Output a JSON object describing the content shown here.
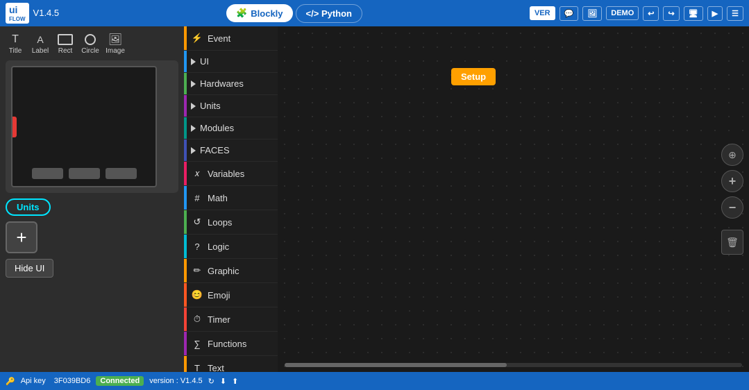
{
  "app": {
    "title": "UI Flow",
    "version": "V1.4.5"
  },
  "topbar": {
    "logo": "UI",
    "logo_sub": "FLOW",
    "version_label": "V1.4.5",
    "tab_blockly": "Blockly",
    "tab_python": "</> Python",
    "btn_ver": "VER",
    "btn_chat": "💬",
    "btn_image": "🖼",
    "btn_demo": "DEMO",
    "btn_undo": "↩",
    "btn_redo": "↪",
    "btn_monitor": "🖥",
    "btn_run": "▶",
    "btn_menu": "☰"
  },
  "left_panel": {
    "tools": [
      {
        "name": "Title",
        "shape": "T"
      },
      {
        "name": "Label",
        "shape": "A"
      },
      {
        "name": "Rect",
        "shape": "▭"
      },
      {
        "name": "Circle",
        "shape": "○"
      },
      {
        "name": "Image",
        "shape": "🖼"
      }
    ],
    "units_badge": "Units",
    "add_button_label": "+",
    "hide_ui_label": "Hide UI"
  },
  "sidebar": {
    "items": [
      {
        "id": "event",
        "label": "Event",
        "color": "#ff9800",
        "has_arrow": false,
        "icon": "⚡"
      },
      {
        "id": "ui",
        "label": "UI",
        "color": "#2196f3",
        "has_arrow": true,
        "icon": ""
      },
      {
        "id": "hardwares",
        "label": "Hardwares",
        "color": "#4caf50",
        "has_arrow": true,
        "icon": ""
      },
      {
        "id": "units",
        "label": "Units",
        "color": "#9c27b0",
        "has_arrow": true,
        "icon": ""
      },
      {
        "id": "modules",
        "label": "Modules",
        "color": "#009688",
        "has_arrow": true,
        "icon": ""
      },
      {
        "id": "faces",
        "label": "FACES",
        "color": "#3f51b5",
        "has_arrow": true,
        "icon": ""
      },
      {
        "id": "variables",
        "label": "Variables",
        "color": "#e91e63",
        "has_arrow": false,
        "icon": "𝑥"
      },
      {
        "id": "math",
        "label": "Math",
        "color": "#2196f3",
        "has_arrow": false,
        "icon": "#"
      },
      {
        "id": "loops",
        "label": "Loops",
        "color": "#4caf50",
        "has_arrow": false,
        "icon": "↺"
      },
      {
        "id": "logic",
        "label": "Logic",
        "color": "#00bcd4",
        "has_arrow": false,
        "icon": "?"
      },
      {
        "id": "graphic",
        "label": "Graphic",
        "color": "#ff9800",
        "has_arrow": false,
        "icon": "✏"
      },
      {
        "id": "emoji",
        "label": "Emoji",
        "color": "#ff5722",
        "has_arrow": false,
        "icon": "😊"
      },
      {
        "id": "timer",
        "label": "Timer",
        "color": "#f44336",
        "has_arrow": false,
        "icon": "⏱"
      },
      {
        "id": "functions",
        "label": "Functions",
        "color": "#9c27b0",
        "has_arrow": false,
        "icon": "∑"
      },
      {
        "id": "text",
        "label": "Text",
        "color": "#ff9800",
        "has_arrow": false,
        "icon": "T"
      }
    ]
  },
  "canvas": {
    "setup_block_label": "Setup"
  },
  "bottombar": {
    "api_key_label": "Api key",
    "api_key_value": "3F039BD6",
    "connected_label": "Connected",
    "version_label": "version : V1.4.5"
  }
}
